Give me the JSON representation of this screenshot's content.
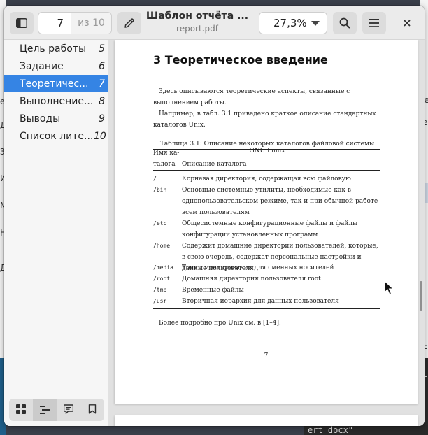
{
  "background": {
    "left_letters": [
      "e",
      "Д",
      "З",
      "И",
      "М",
      "Н",
      "Д"
    ],
    "right_letters": [
      "le",
      "e",
      "E",
      "L"
    ],
    "terminal_text": "ert docx\""
  },
  "header": {
    "page_input": "7",
    "page_total": "из 10",
    "title": "Шаблон отчёта ...",
    "subtitle": "report.pdf",
    "zoom": "27,3%",
    "icons": {
      "sidebar_toggle": "sidebar-toggle-icon",
      "annotate": "pencil-icon",
      "zoom_dropdown": "chevron-down-icon",
      "search": "search-icon",
      "menu": "hamburger-menu-icon",
      "close": "close-icon"
    }
  },
  "sidebar": {
    "toc": [
      {
        "label": "Цель работы",
        "page": "5",
        "selected": false
      },
      {
        "label": "Задание",
        "page": "6",
        "selected": false
      },
      {
        "label": "Теоретичес...",
        "page": "7",
        "selected": true
      },
      {
        "label": "Выполнение...",
        "page": "8",
        "selected": false
      },
      {
        "label": "Выводы",
        "page": "9",
        "selected": false
      },
      {
        "label": "Список лите...",
        "page": "10",
        "selected": false
      }
    ],
    "tabs": [
      {
        "icon": "thumbnails-grid-icon",
        "active": false
      },
      {
        "icon": "outline-list-icon",
        "active": true
      },
      {
        "icon": "annotations-icon",
        "active": false
      },
      {
        "icon": "bookmark-icon",
        "active": false
      }
    ],
    "accent_color": "#3584e4"
  },
  "document": {
    "section_title": "3  Теоретическое введение",
    "para1": "Здесь описываются теоретические аспекты, связанные с выполнением работы.",
    "para2": "Например, в табл. 3.1 приведено краткое описание стандартных каталогов Unix.",
    "table_caption": "Таблица 3.1: Описание некоторых каталогов файловой системы GNU Linux",
    "col1_header": "Имя ка-\nталога",
    "col2_header": "Описание каталога",
    "rows": [
      {
        "dir": "/",
        "desc": "Корневая директория, содержащая всю файловую"
      },
      {
        "dir": "/bin",
        "desc": "Основные системные утилиты, необходимые как в однопользовательском режиме, так и при обычной работе всем пользователям"
      },
      {
        "dir": "/etc",
        "desc": "Общесистемные конфигурационные файлы и файлы конфигурации установленных программ"
      },
      {
        "dir": "/home",
        "desc": "Содержит домашние директории пользователей, которые, в свою очередь, содержат персональные настройки и данные пользователя"
      },
      {
        "dir": "/media",
        "desc": "Точки монтирования для сменных носителей"
      },
      {
        "dir": "/root",
        "desc": "Домашняя директория пользователя root"
      },
      {
        "dir": "/tmp",
        "desc": "Временные файлы"
      },
      {
        "dir": "/usr",
        "desc": "Вторичная иерархия для данных пользователя"
      }
    ],
    "para3": "Более подробно про Unix см. в [1–4].",
    "page_number": "7"
  }
}
